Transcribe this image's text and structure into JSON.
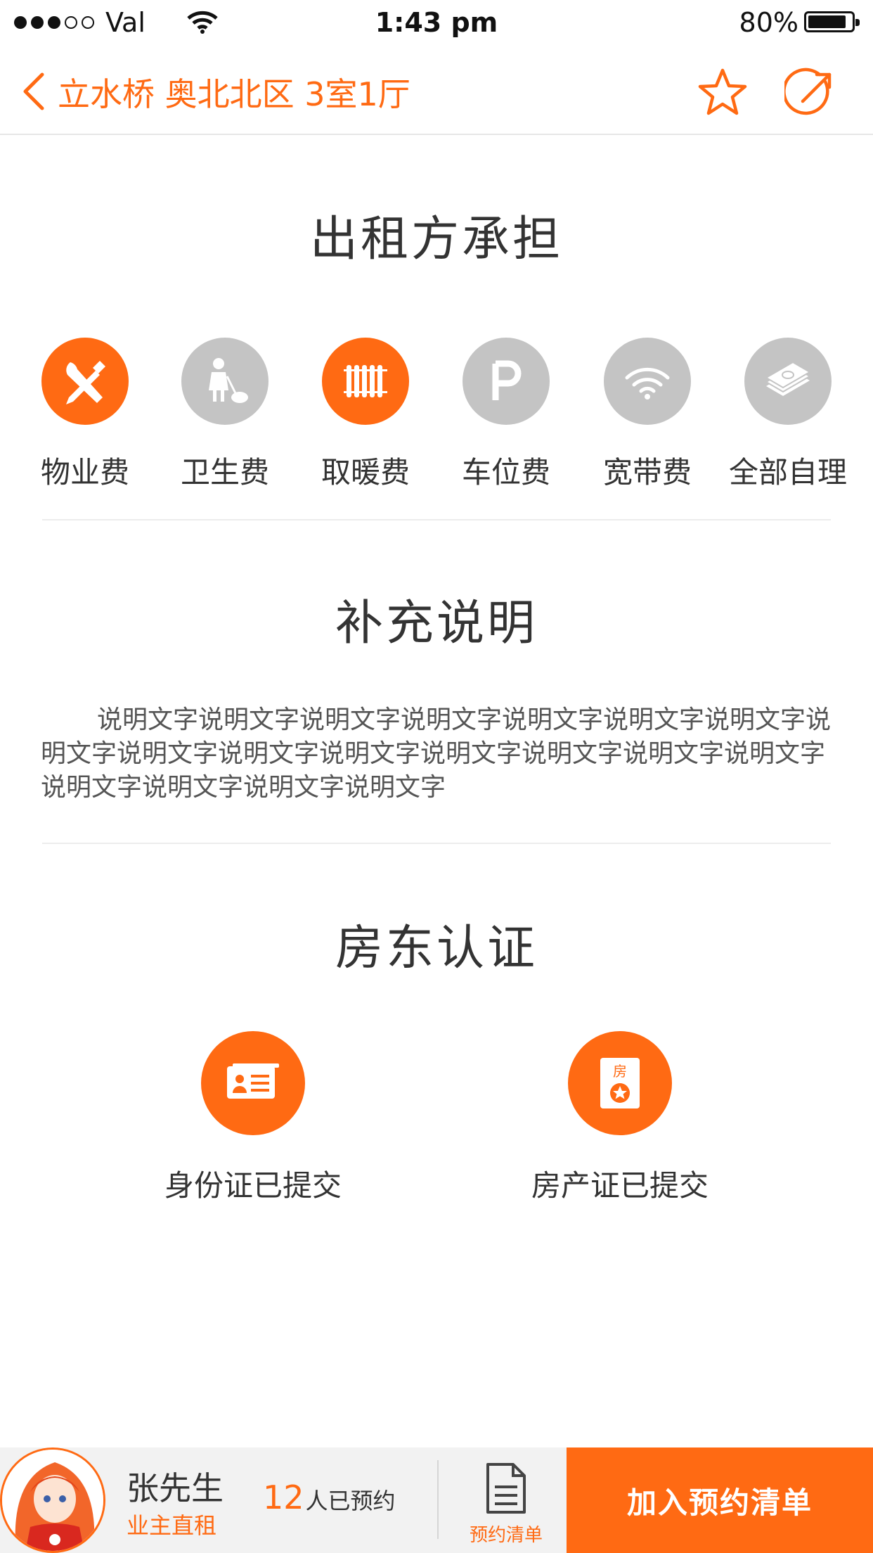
{
  "status_bar": {
    "carrier": "Val",
    "time": "1:43 pm",
    "battery": "80%"
  },
  "nav": {
    "title": "立水桥 奥北北区 3室1厅"
  },
  "fees": {
    "title": "出租方承担",
    "items": [
      {
        "label": "物业费",
        "icon": "wrench-screwdriver-icon",
        "active": true
      },
      {
        "label": "卫生费",
        "icon": "cleaner-icon",
        "active": false
      },
      {
        "label": "取暖费",
        "icon": "radiator-icon",
        "active": true
      },
      {
        "label": "车位费",
        "icon": "parking-icon",
        "active": false
      },
      {
        "label": "宽带费",
        "icon": "wifi-icon",
        "active": false
      },
      {
        "label": "全部自理",
        "icon": "money-icon",
        "active": false
      }
    ]
  },
  "notes": {
    "title": "补充说明",
    "text": "说明文字说明文字说明文字说明文字说明文字说明文字说明文字说明文字说明文字说明文字说明文字说明文字说明文字说明文字说明文字说明文字说明文字说明文字说明文字"
  },
  "certification": {
    "title": "房东认证",
    "items": [
      {
        "label": "身份证已提交",
        "icon": "id-card-icon"
      },
      {
        "label": "房产证已提交",
        "icon": "property-deed-icon",
        "icon_text": "房"
      }
    ]
  },
  "bottom_bar": {
    "owner_name": "张先生",
    "owner_tag": "业主直租",
    "appointment_count": "12",
    "appointment_suffix": "人已预约",
    "list_label": "预约清单",
    "cta_label": "加入预约清单"
  },
  "colors": {
    "accent": "#ff6a13",
    "inactive": "#c4c4c4"
  }
}
